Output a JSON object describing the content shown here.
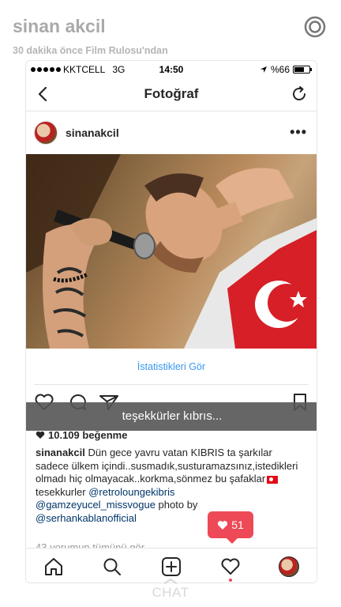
{
  "snap": {
    "username": "sinan akcil",
    "subtitle": "30 dakika önce Film Rulosu'ndan"
  },
  "status_bar": {
    "carrier": "KKTCELL",
    "network": "3G",
    "time": "14:50",
    "battery": "%66",
    "battery_level": 0.66
  },
  "navbar": {
    "title": "Fotoğraf"
  },
  "post": {
    "username": "sinanakcil",
    "more_label": "•••",
    "stats_link": "İstatistikleri Gör",
    "likes": "10.109 beğenme",
    "caption_user": "sinanakcil",
    "caption_text": " Dün gece yavru vatan KIBRIS ta şarkılar sadece ülkem içindi..susmadık,susturamazsınız,istedikleri olmadı hiç olmayacak..korkma,sönmez bu şafaklar",
    "caption_thanks": " tesekkurler ",
    "mention_1": "@retroloungekibris",
    "mention_2": "@gamzeyucel_missvogue",
    "photo_by": " photo by ",
    "mention_3": "@serhankablanofficial",
    "comments_link": "43 yorumun tümünü gör"
  },
  "toast": {
    "text": "teşekkürler kıbrıs..."
  },
  "notification": {
    "likes_count": "51"
  },
  "footer": {
    "chat_label": "CHAT"
  },
  "colors": {
    "link_blue": "#3897f0",
    "mention_blue": "#003569",
    "notification_red": "#ed4956"
  },
  "icons": [
    "circle-ring-icon",
    "back-chevron-icon",
    "refresh-icon",
    "heart-icon",
    "comment-icon",
    "share-icon",
    "bookmark-icon",
    "home-icon",
    "search-icon",
    "add-icon",
    "activity-heart-icon"
  ]
}
